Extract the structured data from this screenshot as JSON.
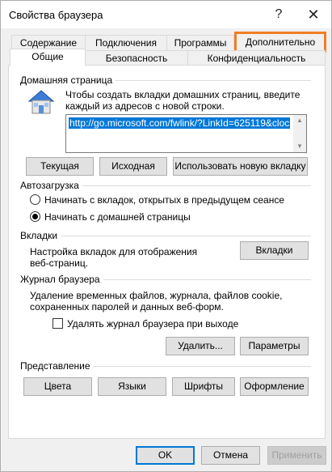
{
  "window": {
    "title": "Свойства браузера",
    "help_glyph": "?",
    "close_glyph": "✕"
  },
  "tabs_row1": [
    "Содержание",
    "Подключения",
    "Программы",
    "Дополнительно"
  ],
  "tabs_row2": [
    "Общие",
    "Безопасность",
    "Конфиденциальность"
  ],
  "home": {
    "section": "Домашняя страница",
    "desc_line1": "Чтобы создать вкладки домашних страниц, введите",
    "desc_line2": "каждый из адресов с новой строки.",
    "url": "http://go.microsoft.com/fwlink/?LinkId=625119&cloc",
    "btn_current": "Текущая",
    "btn_default": "Исходная",
    "btn_newtab": "Использовать новую вкладку"
  },
  "startup": {
    "section": "Автозагрузка",
    "opt1": "Начинать с вкладок, открытых в предыдущем сеансе",
    "opt2": "Начинать с домашней страницы"
  },
  "tabs_section": {
    "section": "Вкладки",
    "desc_line1": "Настройка вкладок для отображения",
    "desc_line2": "веб-страниц.",
    "button": "Вкладки"
  },
  "history": {
    "section": "Журнал браузера",
    "desc_line1": "Удаление временных файлов, журнала, файлов cookie,",
    "desc_line2": "сохраненных паролей и данных веб-форм.",
    "checkbox_label": "Удалять журнал браузера при выходе",
    "btn_delete": "Удалить...",
    "btn_params": "Параметры"
  },
  "appearance": {
    "section": "Представление",
    "btn_colors": "Цвета",
    "btn_languages": "Языки",
    "btn_fonts": "Шрифты",
    "btn_design": "Оформление"
  },
  "footer": {
    "ok": "OK",
    "cancel": "Отмена",
    "apply": "Применить"
  },
  "colors": {
    "highlight": "#f07e26",
    "selection": "#0078d7"
  }
}
